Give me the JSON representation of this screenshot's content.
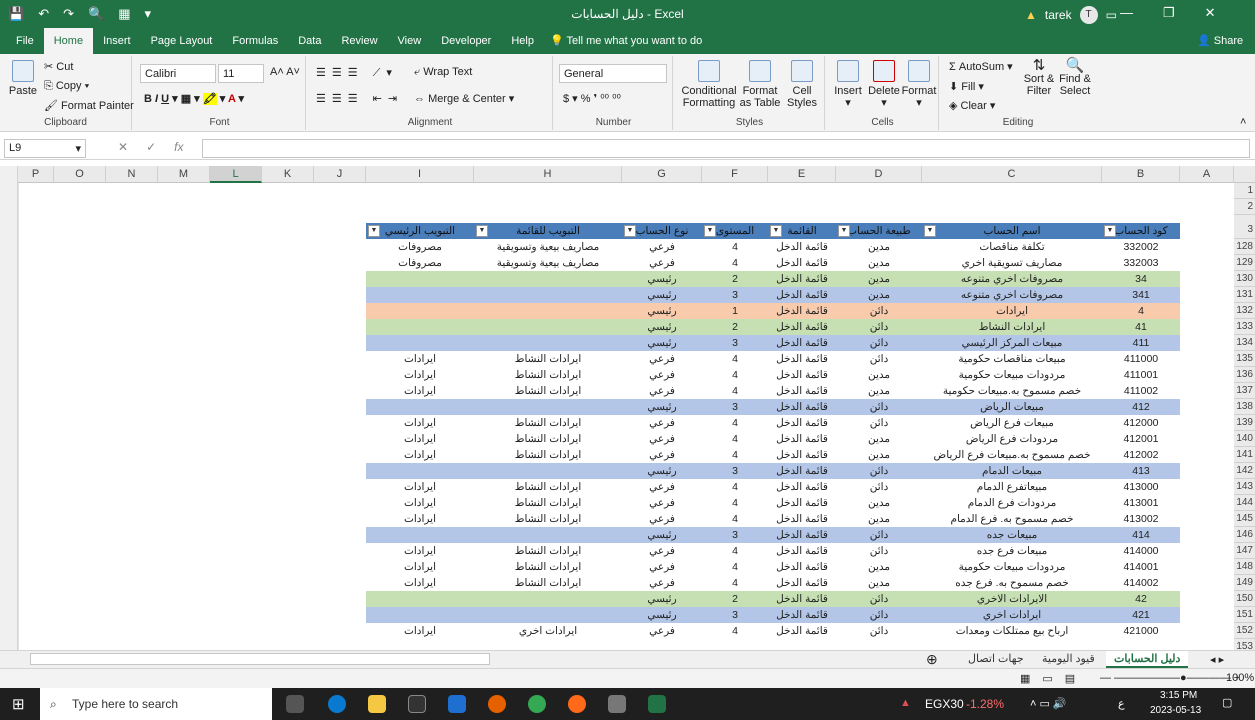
{
  "window": {
    "title": "دليل الحسابات  -  Excel",
    "user": "tarek",
    "avatar_letter": "T"
  },
  "menu_tabs": [
    "File",
    "Home",
    "Insert",
    "Page Layout",
    "Formulas",
    "Data",
    "Review",
    "View",
    "Developer",
    "Help"
  ],
  "tell_me": "Tell me what you want to do",
  "share": "Share",
  "ribbon": {
    "clipboard": {
      "paste": "Paste",
      "cut": "Cut",
      "copy": "Copy",
      "format_painter": "Format Painter",
      "label": "Clipboard"
    },
    "font": {
      "name": "Calibri",
      "size": "11",
      "label": "Font"
    },
    "alignment": {
      "wrap": "Wrap Text",
      "merge": "Merge & Center",
      "label": "Alignment"
    },
    "number": {
      "format": "General",
      "label": "Number"
    },
    "styles": {
      "conditional": "Conditional Formatting",
      "format_table": "Format as Table",
      "cell_styles": "Cell Styles",
      "label": "Styles"
    },
    "cells": {
      "insert": "Insert",
      "delete": "Delete",
      "format": "Format",
      "label": "Cells"
    },
    "editing": {
      "autosum": "AutoSum",
      "fill": "Fill",
      "clear": "Clear",
      "sort": "Sort & Filter",
      "find": "Find & Select",
      "label": "Editing"
    }
  },
  "namebox": "L9",
  "columns": [
    "P",
    "O",
    "N",
    "M",
    "L",
    "K",
    "J",
    "I",
    "H",
    "G",
    "F",
    "E",
    "D",
    "C",
    "B",
    "A"
  ],
  "table_headers": {
    "B": "كود الحساب",
    "C": "اسم الحساب",
    "D": "طبيعة الحساب",
    "E": "القائمة",
    "F": "المستوى",
    "G": "نوع الحساب",
    "H": "التبويب للقائمة",
    "I": "التبويب الرئيسي"
  },
  "rows": [
    {
      "n": "128",
      "b": "332002",
      "c": "تكلفة مناقصات",
      "d": "مدين",
      "e": "قائمة الدخل",
      "f": "4",
      "g": "فرعي",
      "h": "مصاريف بيعية وتسويقية",
      "i": "مصروفات",
      "style": ""
    },
    {
      "n": "129",
      "b": "332003",
      "c": "مصاريف تسويقية اخري",
      "d": "مدين",
      "e": "قائمة الدخل",
      "f": "4",
      "g": "فرعي",
      "h": "مصاريف بيعية وتسويقية",
      "i": "مصروفات",
      "style": ""
    },
    {
      "n": "130",
      "b": "34",
      "c": "مصروفات اخري متنوعه",
      "d": "مدين",
      "e": "قائمة الدخل",
      "f": "2",
      "g": "رئيسي",
      "h": "",
      "i": "",
      "style": "green"
    },
    {
      "n": "131",
      "b": "341",
      "c": "مصروفات اخري متنوعه",
      "d": "مدين",
      "e": "قائمة الدخل",
      "f": "3",
      "g": "رئيسي",
      "h": "",
      "i": "",
      "style": "blue"
    },
    {
      "n": "132",
      "b": "4",
      "c": "ايرادات",
      "d": "دائن",
      "e": "قائمة الدخل",
      "f": "1",
      "g": "رئيسي",
      "h": "",
      "i": "",
      "style": "orange"
    },
    {
      "n": "133",
      "b": "41",
      "c": "ايرادات النشاط",
      "d": "دائن",
      "e": "قائمة الدخل",
      "f": "2",
      "g": "رئيسي",
      "h": "",
      "i": "",
      "style": "green"
    },
    {
      "n": "134",
      "b": "411",
      "c": "مبيعات المركز الرئيسي",
      "d": "دائن",
      "e": "قائمة الدخل",
      "f": "3",
      "g": "رئيسي",
      "h": "",
      "i": "",
      "style": "blue"
    },
    {
      "n": "135",
      "b": "411000",
      "c": "مبيعات مناقصات حكومية",
      "d": "دائن",
      "e": "قائمة الدخل",
      "f": "4",
      "g": "فرعي",
      "h": "ايرادات النشاط",
      "i": "ايرادات",
      "style": ""
    },
    {
      "n": "136",
      "b": "411001",
      "c": "مردودات مبيعات حكومية",
      "d": "مدين",
      "e": "قائمة الدخل",
      "f": "4",
      "g": "فرعي",
      "h": "ايرادات النشاط",
      "i": "ايرادات",
      "style": ""
    },
    {
      "n": "137",
      "b": "411002",
      "c": "خصم مسموح به.مبيعات حكومية",
      "d": "مدين",
      "e": "قائمة الدخل",
      "f": "4",
      "g": "فرعي",
      "h": "ايرادات النشاط",
      "i": "ايرادات",
      "style": ""
    },
    {
      "n": "138",
      "b": "412",
      "c": "مبيعات الرياض",
      "d": "دائن",
      "e": "قائمة الدخل",
      "f": "3",
      "g": "رئيسي",
      "h": "",
      "i": "",
      "style": "blue"
    },
    {
      "n": "139",
      "b": "412000",
      "c": "مبيعات فرع الرياض",
      "d": "دائن",
      "e": "قائمة الدخل",
      "f": "4",
      "g": "فرعي",
      "h": "ايرادات النشاط",
      "i": "ايرادات",
      "style": ""
    },
    {
      "n": "140",
      "b": "412001",
      "c": "مردودات فرع الرياض",
      "d": "مدين",
      "e": "قائمة الدخل",
      "f": "4",
      "g": "فرعي",
      "h": "ايرادات النشاط",
      "i": "ايرادات",
      "style": ""
    },
    {
      "n": "141",
      "b": "412002",
      "c": "خصم مسموح به.مبيعات فرع الرياض",
      "d": "مدين",
      "e": "قائمة الدخل",
      "f": "4",
      "g": "فرعي",
      "h": "ايرادات النشاط",
      "i": "ايرادات",
      "style": ""
    },
    {
      "n": "142",
      "b": "413",
      "c": "مبيعات الدمام",
      "d": "دائن",
      "e": "قائمة الدخل",
      "f": "3",
      "g": "رئيسي",
      "h": "",
      "i": "",
      "style": "blue"
    },
    {
      "n": "143",
      "b": "413000",
      "c": "مبيعاتفرع الدمام",
      "d": "دائن",
      "e": "قائمة الدخل",
      "f": "4",
      "g": "فرعي",
      "h": "ايرادات النشاط",
      "i": "ايرادات",
      "style": ""
    },
    {
      "n": "144",
      "b": "413001",
      "c": "مردودات فرع الدمام",
      "d": "مدين",
      "e": "قائمة الدخل",
      "f": "4",
      "g": "فرعي",
      "h": "ايرادات النشاط",
      "i": "ايرادات",
      "style": ""
    },
    {
      "n": "145",
      "b": "413002",
      "c": "خصم مسموح به. فرع الدمام",
      "d": "مدين",
      "e": "قائمة الدخل",
      "f": "4",
      "g": "فرعي",
      "h": "ايرادات النشاط",
      "i": "ايرادات",
      "style": ""
    },
    {
      "n": "146",
      "b": "414",
      "c": "مبيعات جده",
      "d": "دائن",
      "e": "قائمة الدخل",
      "f": "3",
      "g": "رئيسي",
      "h": "",
      "i": "",
      "style": "blue"
    },
    {
      "n": "147",
      "b": "414000",
      "c": "مبيعات فرع جده",
      "d": "دائن",
      "e": "قائمة الدخل",
      "f": "4",
      "g": "فرعي",
      "h": "ايرادات النشاط",
      "i": "ايرادات",
      "style": ""
    },
    {
      "n": "148",
      "b": "414001",
      "c": "مردودات مبيعات حكومية",
      "d": "مدين",
      "e": "قائمة الدخل",
      "f": "4",
      "g": "فرعي",
      "h": "ايرادات النشاط",
      "i": "ايرادات",
      "style": ""
    },
    {
      "n": "149",
      "b": "414002",
      "c": "خصم مسموح به. فرع جده",
      "d": "مدين",
      "e": "قائمة الدخل",
      "f": "4",
      "g": "فرعي",
      "h": "ايرادات النشاط",
      "i": "ايرادات",
      "style": ""
    },
    {
      "n": "150",
      "b": "42",
      "c": "الايرادات الاخري",
      "d": "دائن",
      "e": "قائمة الدخل",
      "f": "2",
      "g": "رئيسي",
      "h": "",
      "i": "",
      "style": "green"
    },
    {
      "n": "151",
      "b": "421",
      "c": "ايرادات اخري",
      "d": "دائن",
      "e": "قائمة الدخل",
      "f": "3",
      "g": "رئيسي",
      "h": "",
      "i": "",
      "style": "blue"
    },
    {
      "n": "152",
      "b": "421000",
      "c": "ارباح بيع ممتلكات ومعدات",
      "d": "دائن",
      "e": "قائمة الدخل",
      "f": "4",
      "g": "فرعي",
      "h": "ايرادات اخري",
      "i": "ايرادات",
      "style": ""
    }
  ],
  "top_rows": [
    "1",
    "2",
    "3",
    "153"
  ],
  "sheets": [
    "دليل الحسابات",
    "قيود اليومية",
    "جهات اتصال"
  ],
  "status": {
    "zoom": "100%"
  },
  "taskbar": {
    "search": "Type here to search",
    "stock_name": "EGX30",
    "stock_change": "-1.28%",
    "time": "3:15 PM",
    "date": "2023-05-13",
    "lang": "ع"
  },
  "colors": {
    "excel_green": "#217346",
    "header_blue": "#4a7ebb",
    "row_green": "#c6e0b4",
    "row_blue": "#b4c6e7",
    "row_orange": "#f8cbad"
  }
}
